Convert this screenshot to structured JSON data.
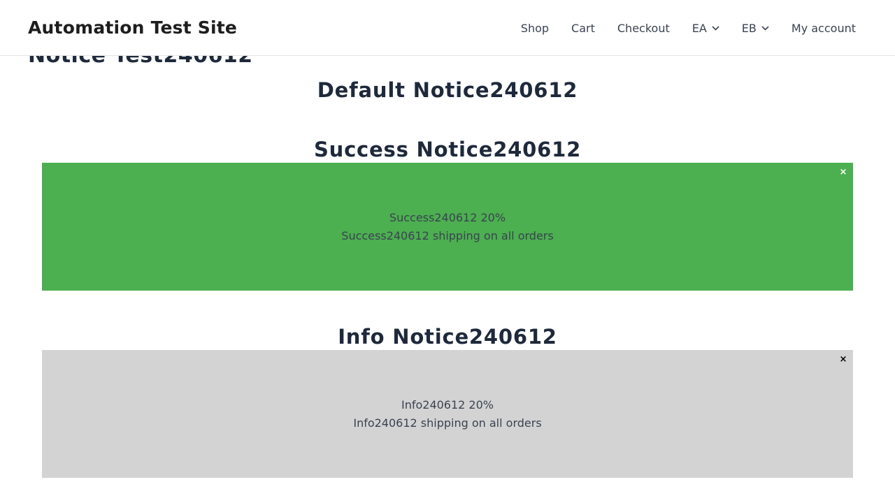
{
  "header": {
    "site_title": "Automation Test Site",
    "nav": [
      {
        "label": "Shop",
        "has_dropdown": false
      },
      {
        "label": "Cart",
        "has_dropdown": false
      },
      {
        "label": "Checkout",
        "has_dropdown": false
      },
      {
        "label": "EA",
        "has_dropdown": true
      },
      {
        "label": "EB",
        "has_dropdown": true
      },
      {
        "label": "My account",
        "has_dropdown": false
      }
    ]
  },
  "main": {
    "page_title": "Notice Test240612",
    "default_notice": {
      "heading": "Default Notice240612"
    },
    "success_notice": {
      "heading": "Success Notice240612",
      "line1": "Success240612 20%",
      "line2": "Success240612 shipping on all orders",
      "close_symbol": "×",
      "background_color": "#4caf50",
      "close_color": "#ffffff"
    },
    "info_notice": {
      "heading": "Info Notice240612",
      "line1": "Info240612 20%",
      "line2": "Info240612 shipping on all orders",
      "close_symbol": "×",
      "background_color": "#d3d3d3",
      "close_color": "#000000"
    }
  },
  "icons": {
    "dropdown": "chevron-down-icon",
    "close": "close-icon"
  }
}
